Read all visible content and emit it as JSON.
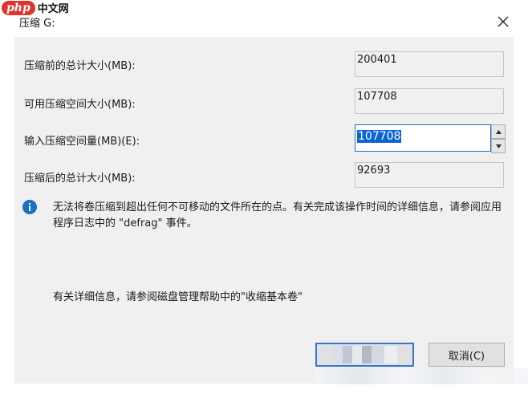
{
  "watermark": {
    "badge": "php",
    "text": "中文网"
  },
  "window": {
    "title": "压缩 G:"
  },
  "rows": {
    "total_before": {
      "label": "压缩前的总计大小(MB):",
      "value": "200401"
    },
    "available": {
      "label": "可用压缩空间大小(MB):",
      "value": "107708"
    },
    "input": {
      "label": "输入压缩空间量(MB)(E):",
      "value": "107708"
    },
    "total_after": {
      "label": "压缩后的总计大小(MB):",
      "value": "92693"
    }
  },
  "info": {
    "text": "无法将卷压缩到超出任何不可移动的文件所在的点。有关完成该操作时间的详细信息，请参阅应用程序日志中的 \"defrag\" 事件。"
  },
  "help": {
    "text": "有关详细信息，请参阅磁盘管理帮助中的\"收缩基本卷\""
  },
  "buttons": {
    "cancel": "取消(C)"
  },
  "icons": {
    "info": "info-icon",
    "close": "close-icon",
    "spin_up": "triangle-up-icon",
    "spin_down": "triangle-down-icon"
  },
  "colors": {
    "accent": "#0a64d2",
    "info_icon": "#1a6fc4",
    "watermark": "#e0322c"
  }
}
